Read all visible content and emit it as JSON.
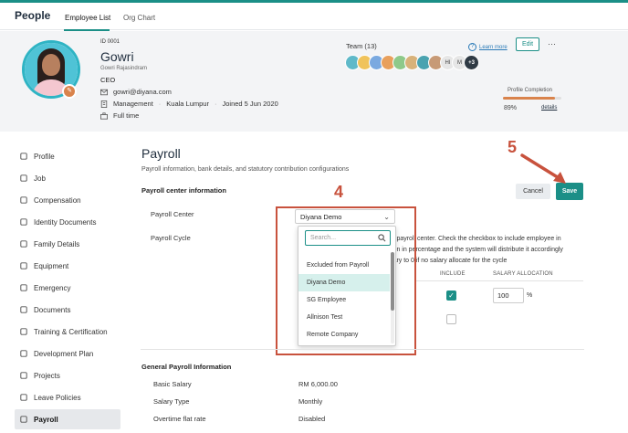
{
  "brand": "People",
  "top_tabs": [
    "Employee List",
    "Org Chart"
  ],
  "profile": {
    "id": "ID 0001",
    "name": "Gowri",
    "full_name": "Gowri Rajasindram",
    "role": "CEO",
    "email": "gowri@diyana.com",
    "department": "Management",
    "location": "Kuala Lumpur",
    "joined": "Joined 5 Jun 2020",
    "employment_type": "Full time",
    "sep": "·"
  },
  "team": {
    "title": "Team (13)",
    "learn_more": "Learn more",
    "initials": [
      "HI",
      "M"
    ],
    "more": "+3",
    "avatar_colors": [
      "#5fb9c9",
      "#f0c35b",
      "#7aa9e0",
      "#e8a05d",
      "#8ec98a",
      "#d8b27a",
      "#4aa3b0",
      "#c79a76",
      "#e6e6e6",
      "#e6e6e6"
    ]
  },
  "header_actions": {
    "edit": "Edit",
    "more": "···"
  },
  "profile_completion": {
    "label": "Profile Completion",
    "value": "89%",
    "fraction": 0.89,
    "details": "details"
  },
  "sidebar": {
    "items": [
      {
        "label": "Profile",
        "icon": "user-icon"
      },
      {
        "label": "Job",
        "icon": "briefcase-icon"
      },
      {
        "label": "Compensation",
        "icon": "money-icon"
      },
      {
        "label": "Identity Documents",
        "icon": "id-card-icon"
      },
      {
        "label": "Family Details",
        "icon": "family-icon"
      },
      {
        "label": "Equipment",
        "icon": "laptop-icon"
      },
      {
        "label": "Emergency",
        "icon": "phone-icon"
      },
      {
        "label": "Documents",
        "icon": "document-icon"
      },
      {
        "label": "Training & Certification",
        "icon": "certificate-icon"
      },
      {
        "label": "Development Plan",
        "icon": "chart-icon"
      },
      {
        "label": "Projects",
        "icon": "projects-icon"
      },
      {
        "label": "Leave Policies",
        "icon": "calendar-icon"
      },
      {
        "label": "Payroll",
        "icon": "payroll-icon",
        "active": true
      }
    ]
  },
  "main": {
    "title": "Payroll",
    "subtitle": "Payroll information, bank details, and statutory contribution configurations",
    "section_title": "Payroll center information",
    "cancel": "Cancel",
    "save": "Save",
    "payroll_center_label": "Payroll Center",
    "payroll_cycle_label": "Payroll Cycle",
    "payroll_center_value": "Diyana Demo",
    "dropdown": {
      "search_placeholder": "Search...",
      "options": [
        "Excluded from Payroll",
        "Diyana Demo",
        "SG Employee",
        "Allnison Test",
        "Remote Company"
      ],
      "selected_index": 1
    },
    "desc_lines": [
      "s payroll center. Check the checkbox to include employee in",
      "ion in percentage and the system will distribute it accordingly",
      "lary to 0 if no salary allocate for the cycle"
    ],
    "include_header": "INCLUDE",
    "allocation_header": "SALARY ALLOCATION",
    "allocation_value": "100",
    "percent": "%",
    "check": "✓",
    "general": {
      "title": "General Payroll Information",
      "rows": [
        {
          "label": "Basic Salary",
          "value": "RM 6,000.00"
        },
        {
          "label": "Salary Type",
          "value": "Monthly"
        },
        {
          "label": "Overtime flat rate",
          "value": "Disabled"
        }
      ]
    }
  },
  "annotations": {
    "step4": "4",
    "step5": "5",
    "color": "#c8523d"
  }
}
